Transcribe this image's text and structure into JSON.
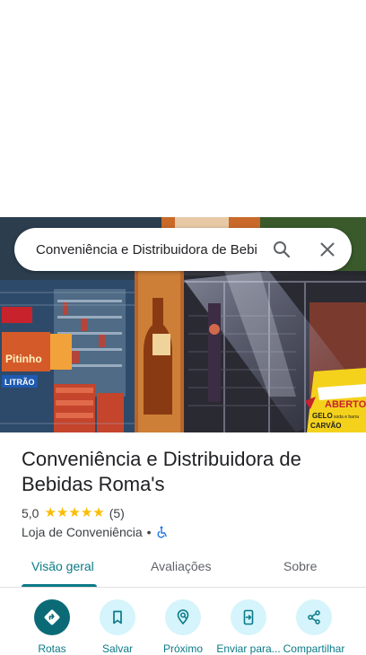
{
  "search": {
    "query": "Conveniência e Distribuidora de Bebidas Roma's",
    "search_icon": "search-icon",
    "close_icon": "close-icon"
  },
  "photo": {
    "signs": [
      "ABERTO",
      "GELO",
      "CARVÃO",
      "LITRÃO",
      "Pitinho"
    ],
    "sign_yellow_sub": "soda e barra"
  },
  "place": {
    "name": "Conveniência e Distribuidora de Bebidas Roma's",
    "rating": "5,0",
    "stars": 5,
    "review_count": "(5)",
    "category": "Loja de Conveniência",
    "separator": "•",
    "accessibility_icon": "wheelchair-icon"
  },
  "tabs": [
    {
      "label": "Visão geral",
      "active": true
    },
    {
      "label": "Avaliações",
      "active": false
    },
    {
      "label": "Sobre",
      "active": false
    }
  ],
  "actions": [
    {
      "label": "Rotas",
      "icon": "directions-icon"
    },
    {
      "label": "Salvar",
      "icon": "bookmark-icon"
    },
    {
      "label": "Próximo",
      "icon": "nearby-icon"
    },
    {
      "label": "Enviar para...",
      "icon": "send-to-phone-icon"
    },
    {
      "label": "Compartilhar",
      "icon": "share-icon"
    }
  ],
  "colors": {
    "accent": "#0b7a87",
    "primary_button": "#0a6b77",
    "button_bg": "#d5f4fb",
    "star": "#fbbc04"
  }
}
